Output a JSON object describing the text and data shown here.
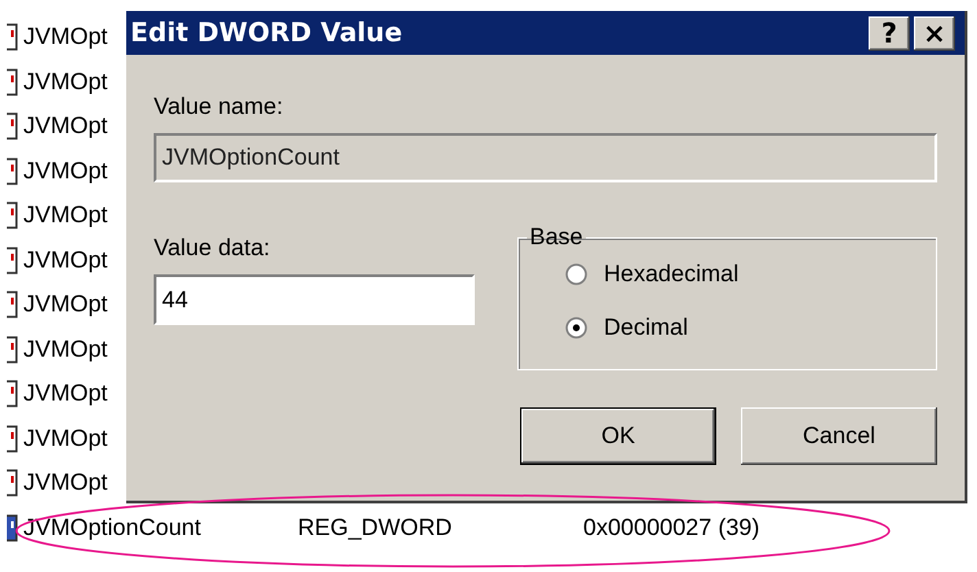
{
  "registry_values": [
    {
      "name": "JVMOpt"
    },
    {
      "name": "JVMOpt"
    },
    {
      "name": "JVMOpt"
    },
    {
      "name": "JVMOpt"
    },
    {
      "name": "JVMOpt"
    },
    {
      "name": "JVMOpt"
    },
    {
      "name": "JVMOpt"
    },
    {
      "name": "JVMOpt"
    },
    {
      "name": "JVMOpt"
    },
    {
      "name": "JVMOpt"
    },
    {
      "name": "JVMOpt"
    },
    {
      "name": "JVMOptionCount",
      "type": "REG_DWORD",
      "data": "0x00000027 (39)"
    }
  ],
  "dialog": {
    "title": "Edit DWORD Value",
    "help_button": "?",
    "close_button": "×",
    "value_name_label": "Value name:",
    "value_name": "JVMOptionCount",
    "value_data_label": "Value data:",
    "value_data": "44",
    "base_group": {
      "title": "Base",
      "options": [
        {
          "label": "Hexadecimal",
          "selected": false
        },
        {
          "label": "Decimal",
          "selected": true
        }
      ]
    },
    "buttons": [
      {
        "label": "OK",
        "default": true
      },
      {
        "label": "Cancel",
        "default": false
      }
    ]
  }
}
